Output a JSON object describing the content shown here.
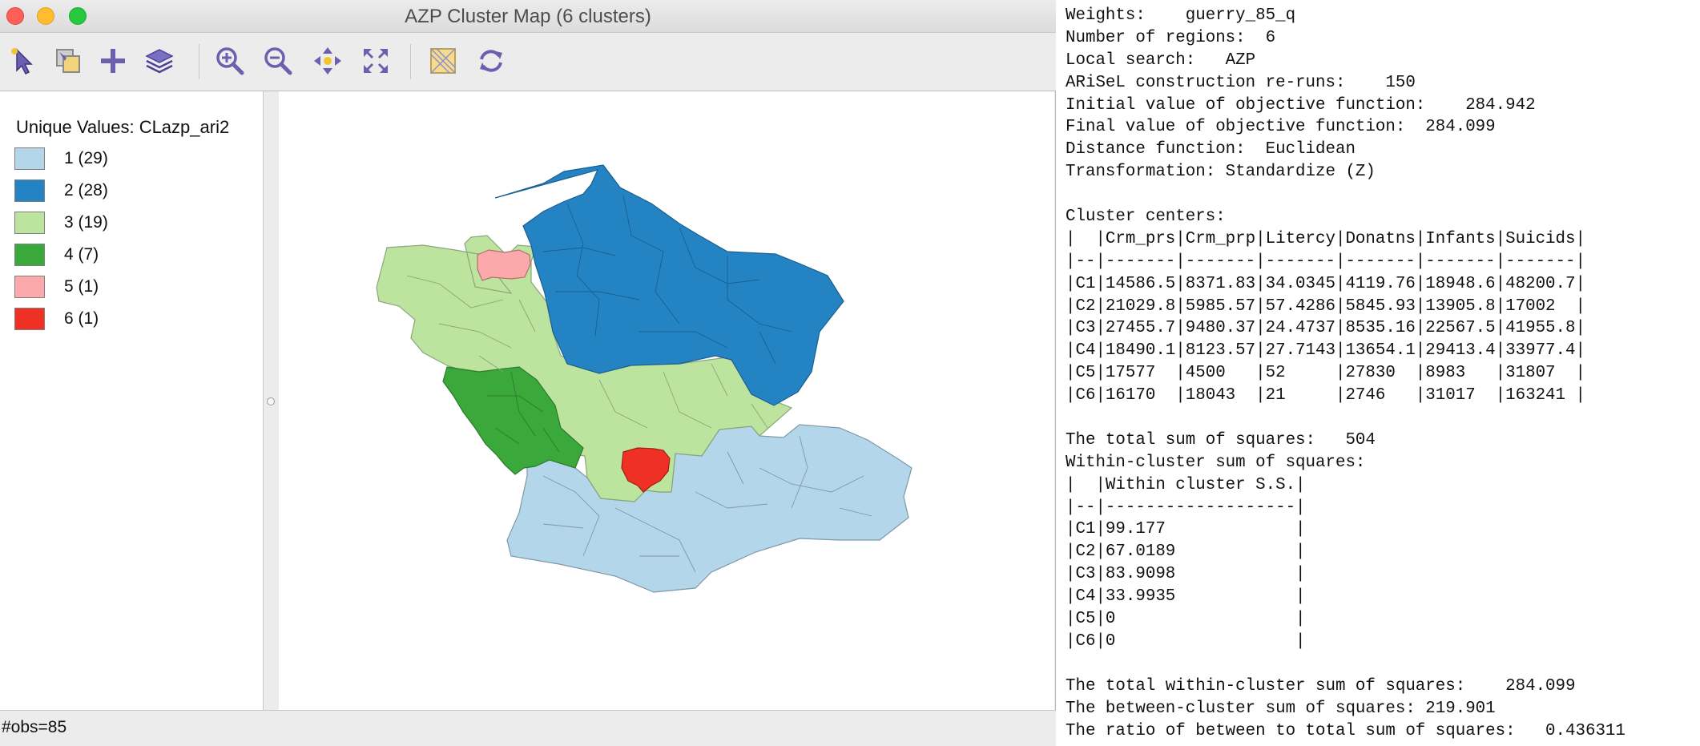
{
  "window": {
    "title": "AZP Cluster Map (6 clusters)"
  },
  "toolbar": {
    "tools": [
      {
        "icon": "select-pointer-icon"
      },
      {
        "icon": "select-shapes-icon"
      },
      {
        "icon": "add-layer-icon"
      },
      {
        "icon": "layers-icon"
      },
      {
        "icon": "zoom-in-icon"
      },
      {
        "icon": "zoom-out-icon"
      },
      {
        "icon": "pan-icon"
      },
      {
        "icon": "fit-extent-icon"
      },
      {
        "icon": "map-options-icon"
      },
      {
        "icon": "refresh-icon"
      }
    ]
  },
  "legend": {
    "title": "Unique Values: CLazp_ari2",
    "items": [
      {
        "label": "1 (29)",
        "color": "#b3d6ea"
      },
      {
        "label": "2 (28)",
        "color": "#2383c3"
      },
      {
        "label": "3 (19)",
        "color": "#bde49f"
      },
      {
        "label": "4 (7)",
        "color": "#3ba83b"
      },
      {
        "label": "5 (1)",
        "color": "#fba9aa"
      },
      {
        "label": "6 (1)",
        "color": "#ee3124"
      }
    ]
  },
  "status": {
    "text": "#obs=85"
  },
  "console": {
    "lines": [
      "Weights:    guerry_85_q",
      "Number of regions:  6",
      "Local search:   AZP",
      "ARiSeL construction re-runs:    150",
      "Initial value of objective function:    284.942",
      "Final value of objective function:  284.099",
      "Distance function:  Euclidean",
      "Transformation: Standardize (Z)",
      "",
      "Cluster centers:",
      "|  |Crm_prs|Crm_prp|Litercy|Donatns|Infants|Suicids|",
      "|--|-------|-------|-------|-------|-------|-------|",
      "|C1|14586.5|8371.83|34.0345|4119.76|18948.6|48200.7|",
      "|C2|21029.8|5985.57|57.4286|5845.93|13905.8|17002  |",
      "|C3|27455.7|9480.37|24.4737|8535.16|22567.5|41955.8|",
      "|C4|18490.1|8123.57|27.7143|13654.1|29413.4|33977.4|",
      "|C5|17577  |4500   |52     |27830  |8983   |31807  |",
      "|C6|16170  |18043  |21     |2746   |31017  |163241 |",
      "",
      "The total sum of squares:   504",
      "Within-cluster sum of squares:",
      "|  |Within cluster S.S.|",
      "|--|-------------------|",
      "|C1|99.177             |",
      "|C2|67.0189            |",
      "|C3|83.9098            |",
      "|C4|33.9935            |",
      "|C5|0                  |",
      "|C6|0                  |",
      "",
      "The total within-cluster sum of squares:    284.099",
      "The between-cluster sum of squares: 219.901",
      "The ratio of between to total sum of squares:   0.436311"
    ]
  }
}
